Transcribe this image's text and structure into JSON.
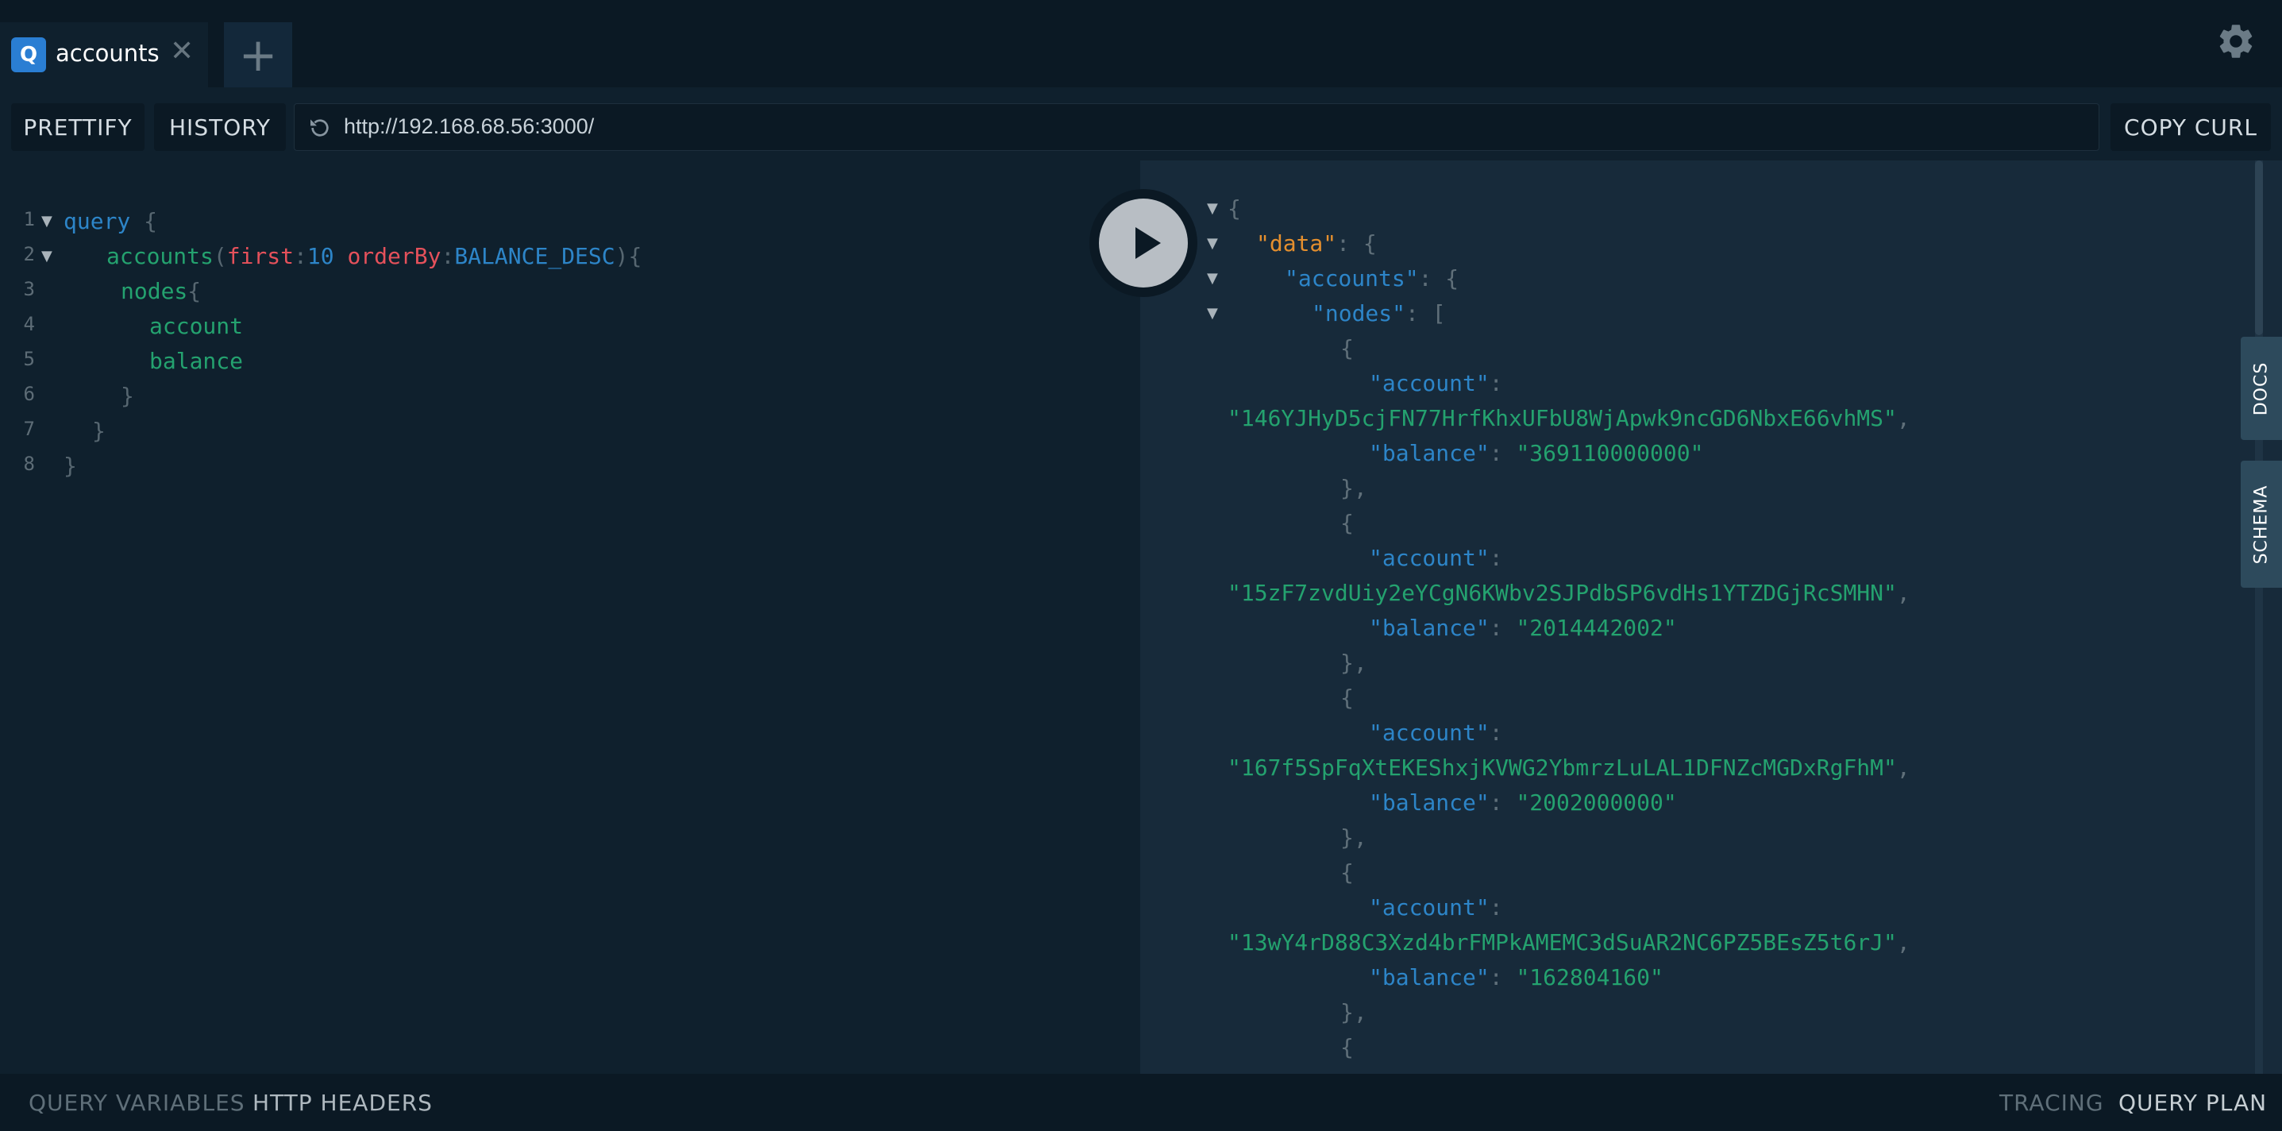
{
  "tab": {
    "badge": "Q",
    "title": "accounts",
    "close_glyph": "✕",
    "add_glyph": "+"
  },
  "toolbar": {
    "prettify": "PRETTIFY",
    "history": "HISTORY",
    "url": "http://192.168.68.56:3000/",
    "copy_curl": "COPY CURL"
  },
  "editor": {
    "line_numbers": [
      "1",
      "2",
      "3",
      "4",
      "5",
      "6",
      "7",
      "8"
    ],
    "query_kw": "query",
    "field_accounts": "accounts",
    "arg_first": "first",
    "val_first": "10",
    "arg_orderby": "orderBy",
    "val_orderby": "BALANCE_DESC",
    "field_nodes": "nodes",
    "field_account": "account",
    "field_balance": "balance"
  },
  "result": {
    "data_key": "\"data\"",
    "accounts_key": "\"accounts\"",
    "nodes_key": "\"nodes\"",
    "account_key": "\"account\"",
    "balance_key": "\"balance\"",
    "nodes": [
      {
        "account": "\"146YJHyD5cjFN77HrfKhxUFbU8WjApwk9ncGD6NbxE66vhMS\"",
        "balance": "\"369110000000\""
      },
      {
        "account": "\"15zF7zvdUiy2eYCgN6KWbv2SJPdbSP6vdHs1YTZDGjRcSMHN\"",
        "balance": "\"2014442002\""
      },
      {
        "account": "\"167f5SpFqXtEKEShxjKVWG2YbmrzLuLAL1DFNZcMGDxRgFhM\"",
        "balance": "\"2002000000\""
      },
      {
        "account": "\"13wY4rD88C3Xzd4brFMPkAMEMC3dSuAR2NC6PZ5BEsZ5t6rJ\"",
        "balance": "\"162804160\""
      }
    ]
  },
  "side_tabs": {
    "docs": "DOCS",
    "schema": "SCHEMA"
  },
  "footer": {
    "query_variables": "QUERY VARIABLES",
    "http_headers": "HTTP HEADERS",
    "tracing": "TRACING",
    "query_plan": "QUERY PLAN"
  },
  "icons": {
    "settings": "gear-icon",
    "refresh": "refresh-icon",
    "play": "play-icon"
  },
  "colors": {
    "accent": "#2a7ed3",
    "field": "#24a26f",
    "argument": "#e5515b",
    "keyword": "#2d85c8",
    "data_key": "#e48f2e"
  }
}
